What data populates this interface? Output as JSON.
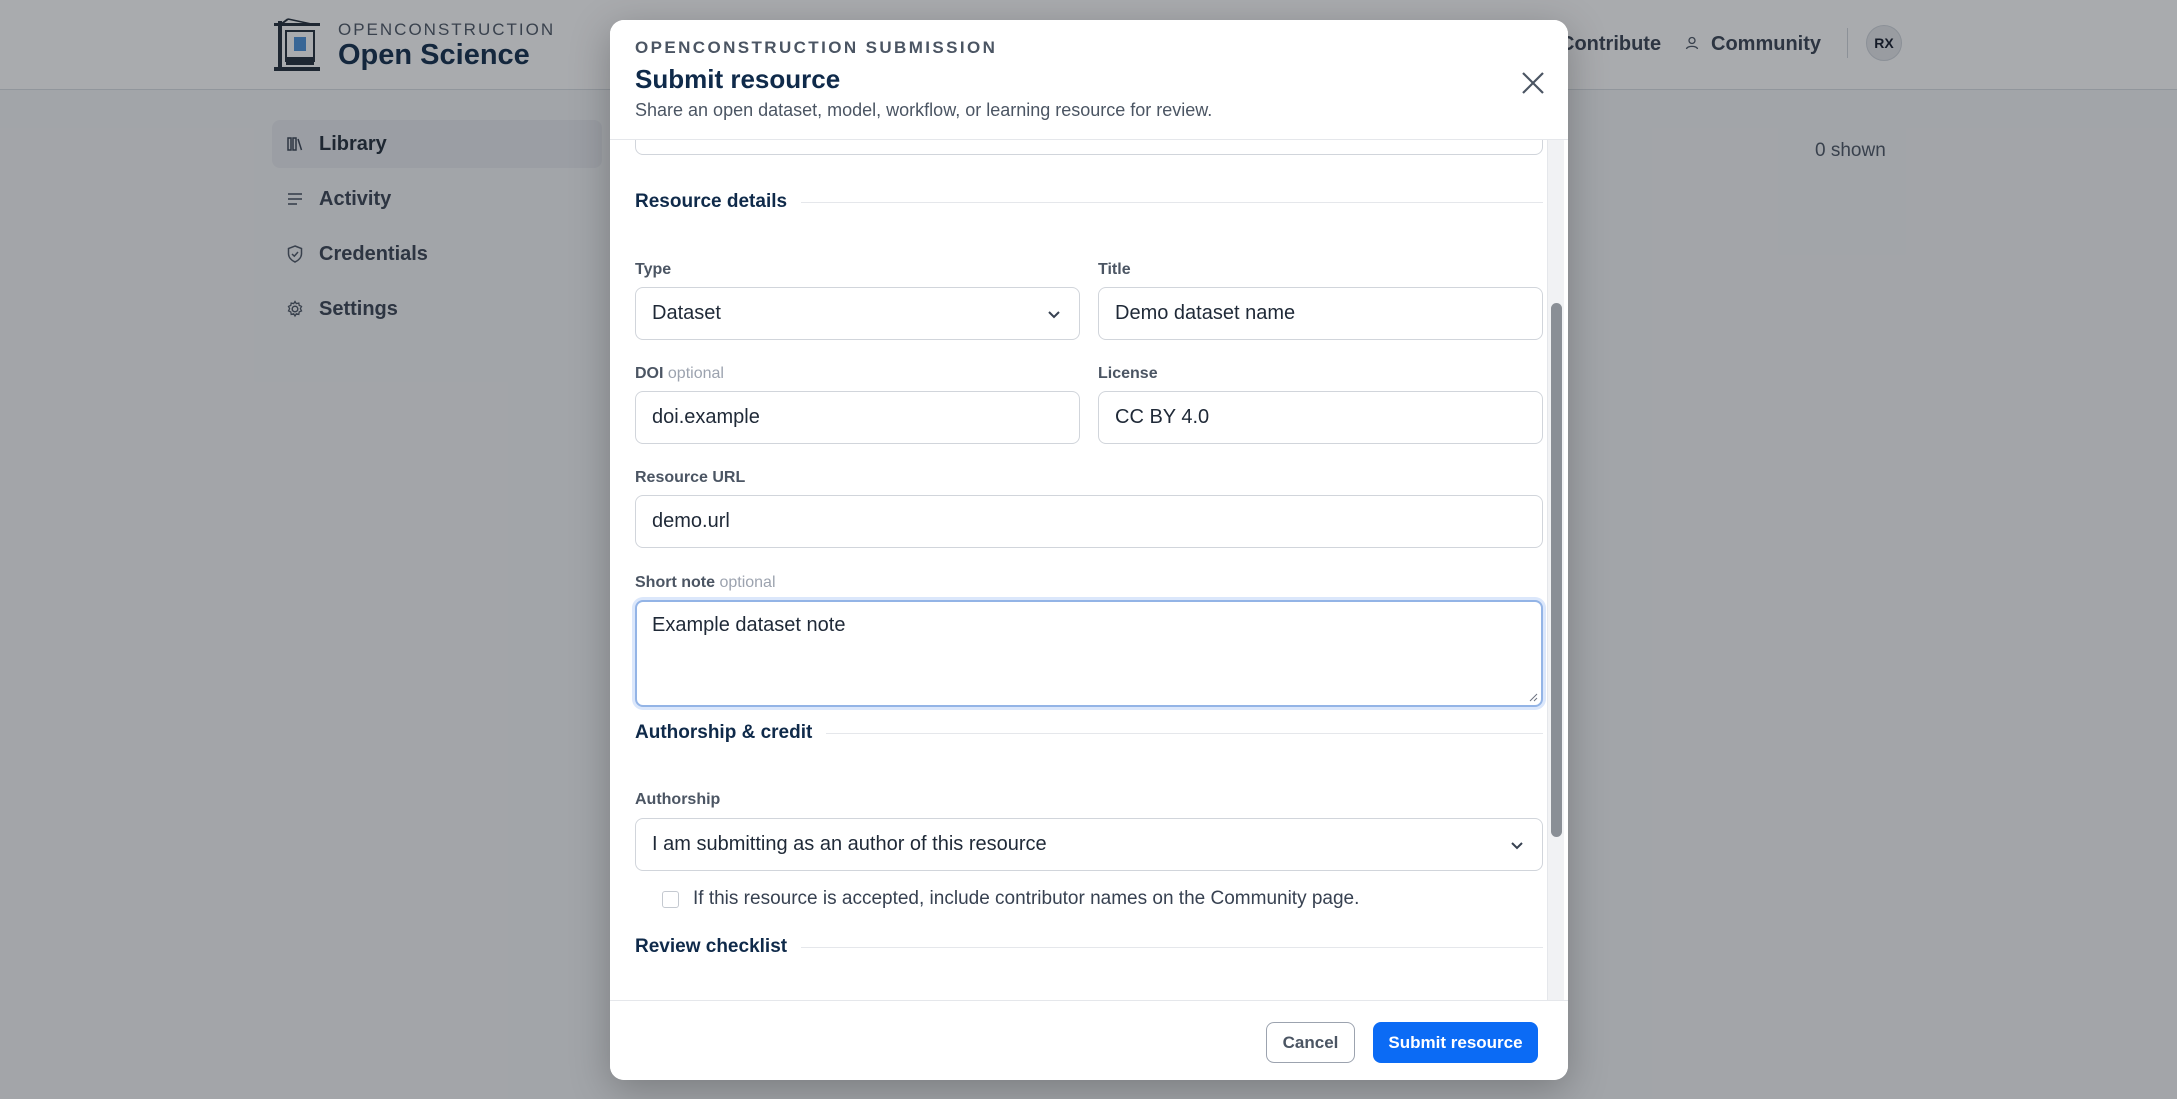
{
  "brand": {
    "small": "OPENCONSTRUCTION",
    "big": "Open Science"
  },
  "topnav": {
    "contribute": "Contribute",
    "community": "Community",
    "avatar_initials": "RX"
  },
  "sidebar": {
    "items": [
      {
        "label": "Library",
        "icon": "library-icon",
        "active": true
      },
      {
        "label": "Activity",
        "icon": "list-icon",
        "active": false
      },
      {
        "label": "Credentials",
        "icon": "shield-check-icon",
        "active": false
      },
      {
        "label": "Settings",
        "icon": "gear-icon",
        "active": false
      }
    ]
  },
  "main": {
    "shown_count": "0 shown"
  },
  "modal": {
    "eyebrow": "OPENCONSTRUCTION SUBMISSION",
    "title": "Submit resource",
    "subtitle": "Share an open dataset, model, workflow, or learning resource for review.",
    "sections": {
      "resource_details": "Resource details",
      "authorship": "Authorship & credit",
      "review": "Review checklist"
    },
    "fields": {
      "type": {
        "label": "Type",
        "value": "Dataset"
      },
      "title": {
        "label": "Title",
        "value": "Demo dataset name"
      },
      "doi": {
        "label": "DOI",
        "optional": "optional",
        "value": "doi.example"
      },
      "license": {
        "label": "License",
        "value": "CC BY 4.0"
      },
      "url": {
        "label": "Resource URL",
        "value": "demo.url"
      },
      "note": {
        "label": "Short note",
        "optional": "optional",
        "value": "Example dataset note"
      },
      "authorship": {
        "label": "Authorship",
        "value": "I am submitting as an author of this resource"
      },
      "credit_checkbox": {
        "label": "If this resource is accepted, include contributor names on the Community page.",
        "checked": false
      }
    },
    "footer": {
      "cancel": "Cancel",
      "submit": "Submit resource"
    }
  },
  "colors": {
    "primary": "#0b6bf5",
    "heading": "#0f2a4a",
    "focus": "#93b4e6"
  }
}
